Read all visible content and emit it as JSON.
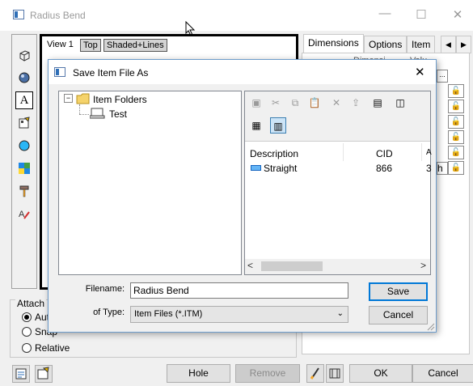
{
  "window": {
    "title": "Radius Bend",
    "minimize": "—",
    "maximize": "☐",
    "close": "✕"
  },
  "viewport": {
    "tabs": [
      "View 1",
      "Top",
      "Shaded+Lines"
    ]
  },
  "right_panel": {
    "tabs": [
      "Dimensions",
      "Options",
      "Item"
    ],
    "partial_headers": [
      "Dimensi",
      "Valu"
    ],
    "partial_field": "h",
    "ellipsis": "..."
  },
  "attach": {
    "label": "Attach",
    "options": [
      {
        "label": "Aut",
        "selected": true
      },
      {
        "label": "Snap",
        "selected": false
      },
      {
        "label": "Relative",
        "selected": false
      }
    ]
  },
  "bottom_buttons": {
    "hole": "Hole",
    "remove": "Remove",
    "ok": "OK",
    "cancel": "Cancel"
  },
  "dialog": {
    "title": "Save Item File As",
    "close": "✕",
    "tree": {
      "root": "Item Folders",
      "child": "Test",
      "expander": "⊟"
    },
    "file_list": {
      "columns": [
        "Description",
        "CID",
        "A"
      ],
      "rows": [
        {
          "description": "Straight",
          "cid": "866",
          "extra": "3"
        }
      ],
      "scroll_left": "<",
      "scroll_right": ">"
    },
    "filename_label": "Filename:",
    "filename_value": "Radius Bend",
    "type_label": "of Type:",
    "type_value": "Item Files (*.ITM)",
    "save": "Save",
    "cancel": "Cancel"
  },
  "colors": {
    "accent": "#0078d7",
    "dialog_border": "#6d9ccb",
    "selected_icon_bg": "#cce4f7"
  }
}
